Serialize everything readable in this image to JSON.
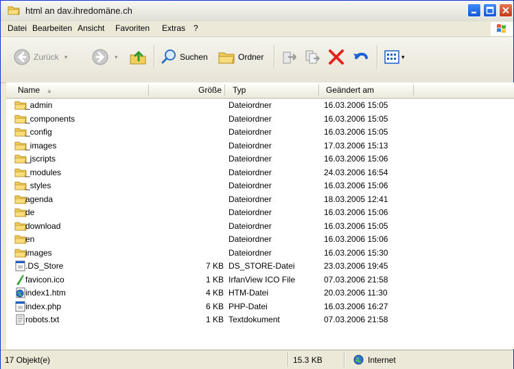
{
  "window": {
    "title": "html an dav.ihredomäne.ch"
  },
  "menu": [
    "Datei",
    "Bearbeiten",
    "Ansicht",
    "Favoriten",
    "Extras",
    "?"
  ],
  "toolbar": {
    "back": "Zurück",
    "search": "Suchen",
    "folders": "Ordner"
  },
  "columns": {
    "name": "Name",
    "size": "Größe",
    "type": "Typ",
    "modified": "Geändert am"
  },
  "files": [
    {
      "name": "_admin",
      "size": "",
      "type": "Dateiordner",
      "modified": "16.03.2006 15:05",
      "icon": "folder-icon"
    },
    {
      "name": "_components",
      "size": "",
      "type": "Dateiordner",
      "modified": "16.03.2006 15:05",
      "icon": "folder-icon"
    },
    {
      "name": "_config",
      "size": "",
      "type": "Dateiordner",
      "modified": "16.03.2006 15:05",
      "icon": "folder-icon"
    },
    {
      "name": "_images",
      "size": "",
      "type": "Dateiordner",
      "modified": "17.03.2006 15:13",
      "icon": "folder-icon"
    },
    {
      "name": "_jscripts",
      "size": "",
      "type": "Dateiordner",
      "modified": "16.03.2006 15:06",
      "icon": "folder-icon"
    },
    {
      "name": "_modules",
      "size": "",
      "type": "Dateiordner",
      "modified": "24.03.2006 16:54",
      "icon": "folder-icon"
    },
    {
      "name": "_styles",
      "size": "",
      "type": "Dateiordner",
      "modified": "16.03.2006 15:06",
      "icon": "folder-icon"
    },
    {
      "name": "agenda",
      "size": "",
      "type": "Dateiordner",
      "modified": "18.03.2005 12:41",
      "icon": "folder-icon"
    },
    {
      "name": "de",
      "size": "",
      "type": "Dateiordner",
      "modified": "16.03.2006 15:06",
      "icon": "folder-icon"
    },
    {
      "name": "download",
      "size": "",
      "type": "Dateiordner",
      "modified": "16.03.2006 15:05",
      "icon": "folder-icon"
    },
    {
      "name": "en",
      "size": "",
      "type": "Dateiordner",
      "modified": "16.03.2006 15:06",
      "icon": "folder-icon"
    },
    {
      "name": "images",
      "size": "",
      "type": "Dateiordner",
      "modified": "16.03.2006 15:30",
      "icon": "folder-icon"
    },
    {
      "name": ".DS_Store",
      "size": "7 KB",
      "type": "DS_STORE-Datei",
      "modified": "23.03.2006 19:45",
      "icon": "app-file-icon"
    },
    {
      "name": "favicon.ico",
      "size": "1 KB",
      "type": "IrfanView ICO File",
      "modified": "07.03.2006 21:58",
      "icon": "ico-file-icon"
    },
    {
      "name": "index1.htm",
      "size": "4 KB",
      "type": "HTM-Datei",
      "modified": "20.03.2006 11:30",
      "icon": "htm-file-icon"
    },
    {
      "name": "index.php",
      "size": "6 KB",
      "type": "PHP-Datei",
      "modified": "16.03.2006 16:27",
      "icon": "app-file-icon"
    },
    {
      "name": "robots.txt",
      "size": "1 KB",
      "type": "Textdokument",
      "modified": "07.03.2006 21:58",
      "icon": "text-file-icon"
    }
  ],
  "status": {
    "objects": "17 Objekt(e)",
    "total_size": "15.3 KB",
    "zone": "Internet"
  }
}
